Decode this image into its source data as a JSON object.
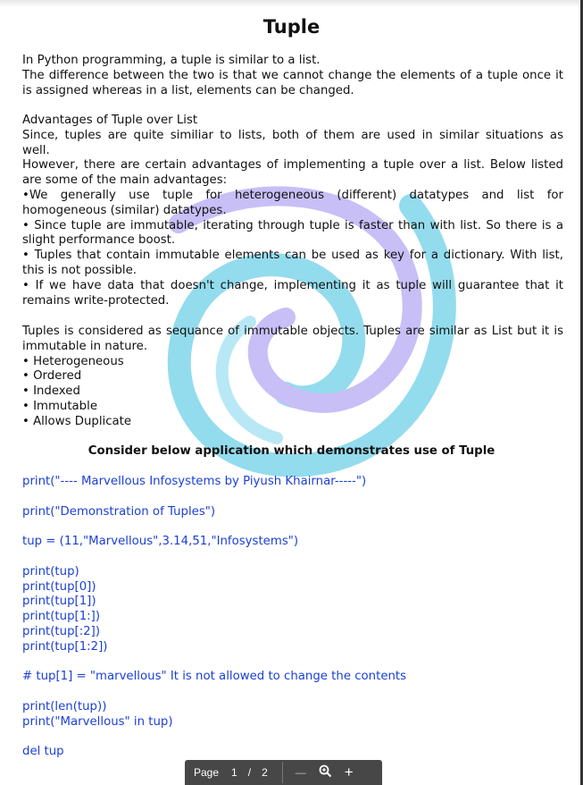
{
  "title": "Tuple",
  "intro": [
    "In Python programming, a tuple is similar to a list.",
    "The difference between the two is that we cannot change the elements of a tuple once it",
    "is assigned whereas in a list, elements can be changed."
  ],
  "advantages": [
    "Advantages of Tuple over List",
    "Since, tuples are quite similiar to lists, both of them are used in similar situations as",
    "well.",
    "However, there are certain advantages of implementing a tuple over a list. Below listed",
    "are some of the main advantages:",
    "•We generally use tuple for heterogeneous (different) datatypes and list for",
    "homogeneous (similar) datatypes.",
    "• Since tuple are immutable, iterating through tuple is faster than with list. So there is a",
    "slight performance boost.",
    "• Tuples that contain immutable elements can be used as key for a dictionary. With list,",
    "this is not possible.",
    "• If we have data that doesn't change, implementing it as tuple will guarantee that it",
    "remains write-protected."
  ],
  "features": [
    "Tuples is considered as sequance of immutable objects. Tuples are similar as List but it is",
    "immutable in nature.",
    "• Heterogeneous",
    "• Ordered",
    "• Indexed",
    "• Immutable",
    "• Allows Duplicate"
  ],
  "heading": "Consider below application which demonstrates use of Tuple",
  "code": [
    "print(\"---- Marvellous Infosystems by Piyush Khairnar-----\")",
    "",
    "print(\"Demonstration of Tuples\")",
    "",
    "tup = (11,\"Marvellous\",3.14,51,\"Infosystems\")",
    "",
    "print(tup)",
    "print(tup[0])",
    "print(tup[1])",
    "print(tup[1:])",
    "print(tup[:2])",
    "print(tup[1:2])",
    "",
    "# tup[1] = \"marvellous\" It is not allowed to change the contents",
    "",
    "print(len(tup))",
    "print(\"Marvellous\" in tup)",
    "",
    "del tup"
  ],
  "toolbar": {
    "page_label": "Page",
    "current_page": "1",
    "separator": "/",
    "total_pages": "2",
    "zoom_out": "—",
    "zoom_in": "+",
    "zoom_icon": "magnifier-icon"
  },
  "colors": {
    "code": "#1b3fd6",
    "toolbar": "#474747"
  }
}
